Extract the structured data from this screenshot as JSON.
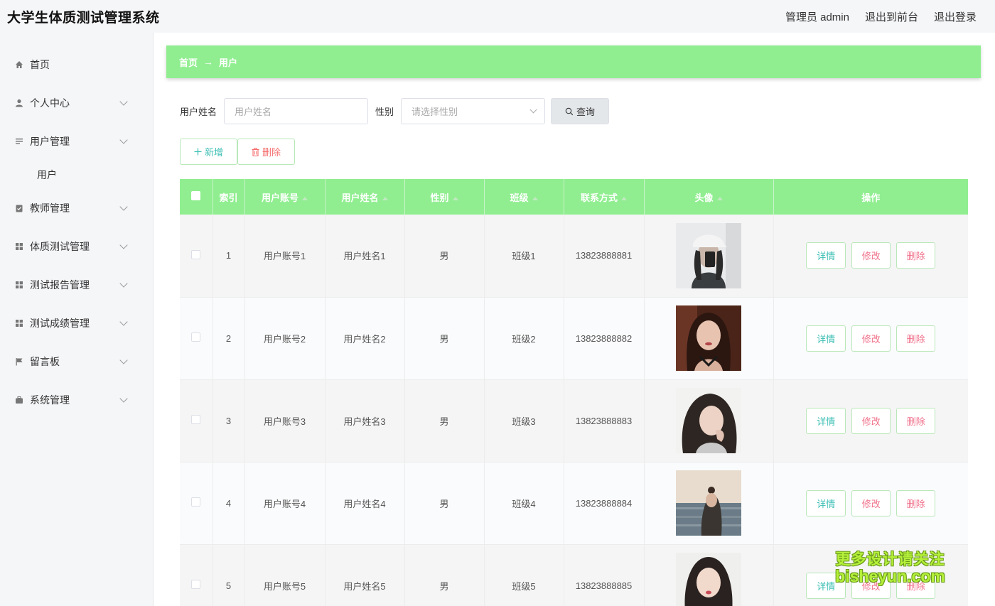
{
  "header": {
    "title": "大学生体质测试管理系统",
    "admin_label": "管理员 admin",
    "to_front_label": "退出到前台",
    "logout_label": "退出登录"
  },
  "sidebar": {
    "items": [
      {
        "label": "首页",
        "icon": "home-icon"
      },
      {
        "label": "个人中心",
        "icon": "person-icon"
      },
      {
        "label": "用户管理",
        "icon": "list-icon"
      },
      {
        "label": "教师管理",
        "icon": "clipboard-icon"
      },
      {
        "label": "体质测试管理",
        "icon": "grid-icon"
      },
      {
        "label": "测试报告管理",
        "icon": "grid-icon"
      },
      {
        "label": "测试成绩管理",
        "icon": "grid-icon"
      },
      {
        "label": "留言板",
        "icon": "flag-icon"
      },
      {
        "label": "系统管理",
        "icon": "briefcase-icon"
      }
    ],
    "sub_user": "用户"
  },
  "breadcrumb": {
    "home": "首页",
    "current": "用户"
  },
  "search": {
    "name_label": "用户姓名",
    "name_placeholder": "用户姓名",
    "gender_label": "性别",
    "gender_placeholder": "请选择性别",
    "query_label": "查询"
  },
  "actions": {
    "add_label": "新增",
    "delete_label": "删除"
  },
  "table": {
    "columns": [
      "索引",
      "用户账号",
      "用户姓名",
      "性别",
      "班级",
      "联系方式",
      "头像",
      "操作"
    ],
    "rows": [
      {
        "index": "1",
        "account": "用户账号1",
        "name": "用户姓名1",
        "gender": "男",
        "class": "班级1",
        "phone": "13823888881"
      },
      {
        "index": "2",
        "account": "用户账号2",
        "name": "用户姓名2",
        "gender": "男",
        "class": "班级2",
        "phone": "13823888882"
      },
      {
        "index": "3",
        "account": "用户账号3",
        "name": "用户姓名3",
        "gender": "男",
        "class": "班级3",
        "phone": "13823888883"
      },
      {
        "index": "4",
        "account": "用户账号4",
        "name": "用户姓名4",
        "gender": "男",
        "class": "班级4",
        "phone": "13823888884"
      },
      {
        "index": "5",
        "account": "用户账号5",
        "name": "用户姓名5",
        "gender": "男",
        "class": "班级5",
        "phone": "13823888885"
      }
    ],
    "op_detail": "详情",
    "op_edit": "修改",
    "op_delete": "删除"
  },
  "watermark": {
    "line1": "更多设计请关注",
    "line2": "bisheyun.com"
  },
  "colors": {
    "accent_green": "#90ee90",
    "teal_text": "#3cbfb4",
    "red_text": "#f56c6c",
    "pink_text": "#f0708a"
  }
}
